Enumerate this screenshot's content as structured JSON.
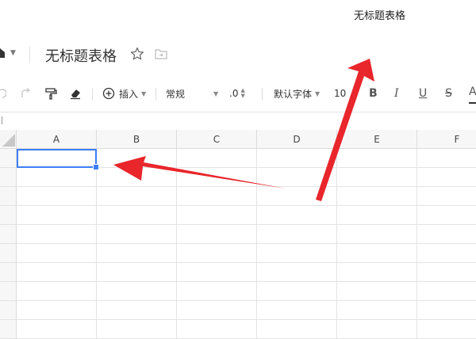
{
  "window": {
    "title": "无标题表格"
  },
  "doc": {
    "title": "无标题表格"
  },
  "toolbar": {
    "insert_label": "插入",
    "format_value": "常规",
    "decimal_label": ".0",
    "font_family": "默认字体",
    "font_size": "10",
    "bold_label": "B",
    "italic_label": "I",
    "underline_label": "U",
    "strike_label": "S",
    "font_color_label": "A"
  },
  "grid": {
    "columns": [
      "A",
      "B",
      "C",
      "D",
      "E",
      "F"
    ],
    "selected_cell": "A1"
  },
  "colors": {
    "accent": "#3d7ef7",
    "annotation_arrow": "#e8262b"
  },
  "icons": [
    "home-icon",
    "star-icon",
    "folder-icon",
    "undo-icon",
    "redo-icon",
    "format-painter-icon",
    "eraser-icon",
    "plus-circle-icon"
  ]
}
